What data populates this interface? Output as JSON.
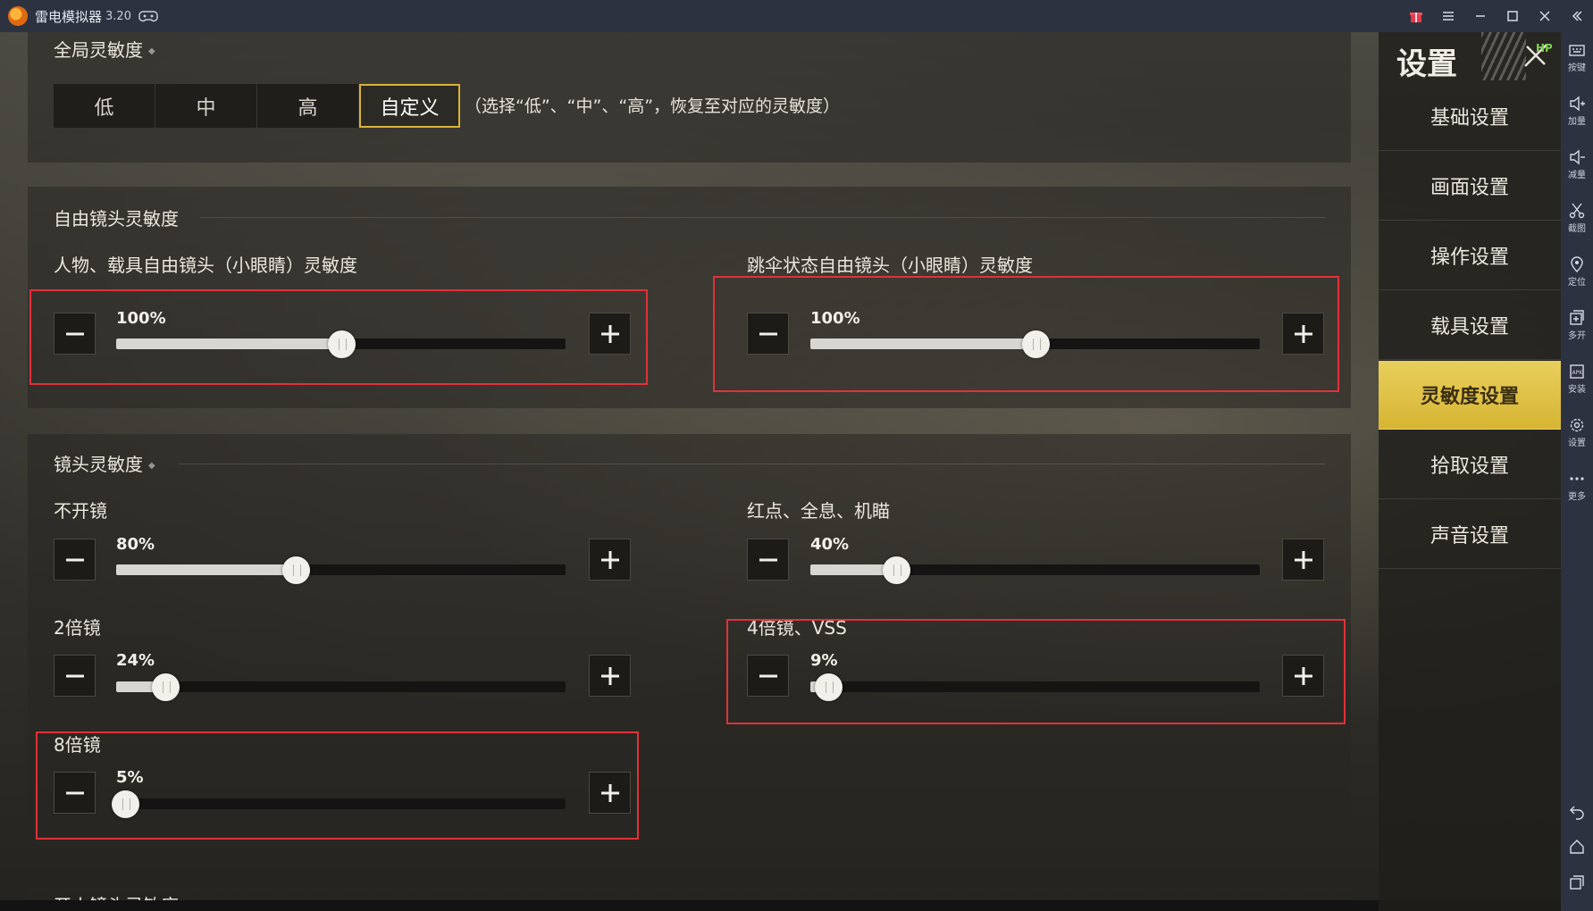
{
  "titlebar": {
    "app_name": "雷电模拟器",
    "version": "3.20"
  },
  "global": {
    "title": "全局灵敏度",
    "presets": [
      "低",
      "中",
      "高",
      "自定义"
    ],
    "active_preset": "自定义",
    "hint": "（选择“低”、“中”、“高”，恢复至对应的灵敏度）"
  },
  "free_camera": {
    "title": "自由镜头灵敏度",
    "left": {
      "label": "人物、载具自由镜头（小眼睛）灵敏度",
      "value_text": "100%",
      "value": 0.5
    },
    "right": {
      "label": "跳伞状态自由镜头（小眼睛）灵敏度",
      "value_text": "100%",
      "value": 0.5
    }
  },
  "scope": {
    "title": "镜头灵敏度",
    "no_scope": {
      "label": "不开镜",
      "value_text": "80%",
      "value": 0.4
    },
    "red_dot": {
      "label": "红点、全息、机瞄",
      "value_text": "40%",
      "value": 0.19
    },
    "x2": {
      "label": "2倍镜",
      "value_text": "24%",
      "value": 0.11
    },
    "x4": {
      "label": "4倍镜、VSS",
      "value_text": "9%",
      "value": 0.04
    },
    "x8": {
      "label": "8倍镜",
      "value_text": "5%",
      "value": 0.02
    }
  },
  "fire_section": {
    "title": "开火镜头灵敏度"
  },
  "settings_menu": {
    "title": "设置",
    "items": [
      "基础设置",
      "画面设置",
      "操作设置",
      "载具设置",
      "灵敏度设置",
      "拾取设置",
      "声音设置"
    ],
    "active": "灵敏度设置"
  },
  "sidebar": {
    "items": [
      {
        "icon": "keyboard-icon",
        "label": "按键"
      },
      {
        "icon": "volume-up-icon",
        "label": "加量"
      },
      {
        "icon": "volume-down-icon",
        "label": "减量"
      },
      {
        "icon": "scissors-icon",
        "label": "截图"
      },
      {
        "icon": "location-icon",
        "label": "定位"
      },
      {
        "icon": "multi-window-icon",
        "label": "多开"
      },
      {
        "icon": "apk-install-icon",
        "label": "安装"
      },
      {
        "icon": "gear-icon",
        "label": "设置"
      },
      {
        "icon": "more-icon",
        "label": "更多"
      }
    ]
  },
  "colors": {
    "accent_yellow": "#d7b533",
    "highlight_red": "#e0313a",
    "titlebar_bg": "#2d3240"
  }
}
